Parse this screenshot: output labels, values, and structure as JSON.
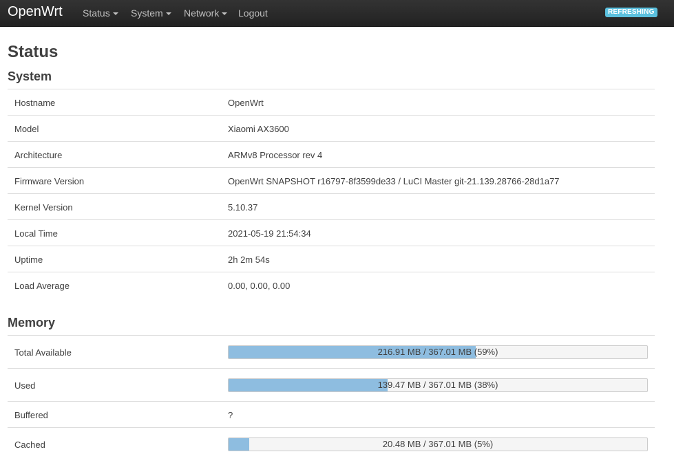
{
  "nav": {
    "brand": "OpenWrt",
    "items": [
      {
        "label": "Status",
        "dropdown": true
      },
      {
        "label": "System",
        "dropdown": true
      },
      {
        "label": "Network",
        "dropdown": true
      },
      {
        "label": "Logout",
        "dropdown": false
      }
    ],
    "badge": "REFRESHING"
  },
  "page": {
    "title": "Status"
  },
  "system": {
    "title": "System",
    "rows": [
      {
        "label": "Hostname",
        "value": "OpenWrt"
      },
      {
        "label": "Model",
        "value": "Xiaomi AX3600"
      },
      {
        "label": "Architecture",
        "value": "ARMv8 Processor rev 4"
      },
      {
        "label": "Firmware Version",
        "value": "OpenWrt SNAPSHOT r16797-8f3599de33 / LuCI Master git-21.139.28766-28d1a77"
      },
      {
        "label": "Kernel Version",
        "value": "5.10.37"
      },
      {
        "label": "Local Time",
        "value": "2021-05-19 21:54:34"
      },
      {
        "label": "Uptime",
        "value": "2h 2m 54s"
      },
      {
        "label": "Load Average",
        "value": "0.00, 0.00, 0.00"
      }
    ]
  },
  "memory": {
    "title": "Memory",
    "rows": [
      {
        "label": "Total Available",
        "text": "216.91 MB / 367.01 MB (59%)",
        "percent": 59
      },
      {
        "label": "Used",
        "text": "139.47 MB / 367.01 MB (38%)",
        "percent": 38
      },
      {
        "label": "Buffered",
        "value": "?"
      },
      {
        "label": "Cached",
        "text": "20.48 MB / 367.01 MB (5%)",
        "percent": 5
      }
    ]
  },
  "colors": {
    "navbar": "#222222",
    "badge": "#5bc0de",
    "progress_fill": "#8ebde0"
  }
}
